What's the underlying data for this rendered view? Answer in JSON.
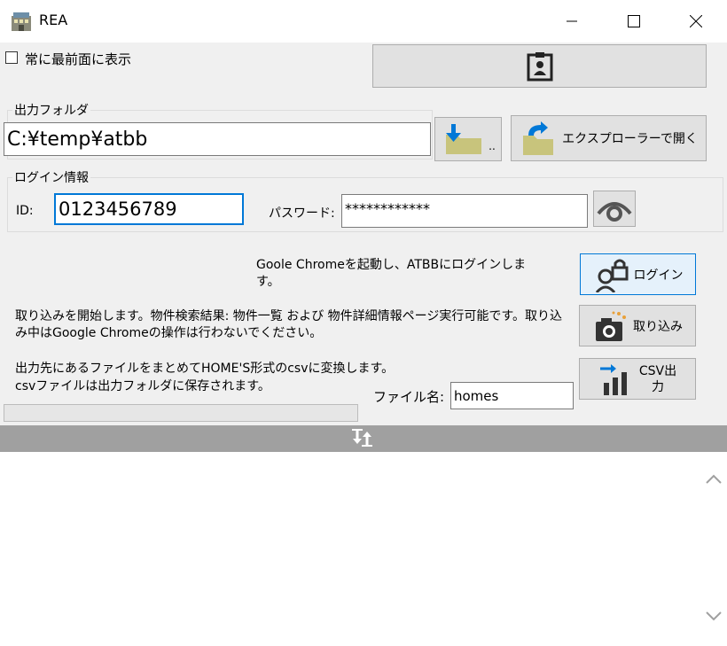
{
  "window": {
    "title": "REA"
  },
  "top": {
    "always_on_top_label": "常に最前面に表示"
  },
  "output_folder": {
    "legend": "出力フォルダ",
    "path_value": "C:¥temp¥atbb",
    "browse_suffix": "..",
    "open_explorer_label": "エクスプローラーで開く"
  },
  "login_info": {
    "legend": "ログイン情報",
    "id_label": "ID:",
    "id_value": "0123456789",
    "password_label": "パスワード:",
    "password_value": "************"
  },
  "actions": {
    "login_description": "Goole Chromeを起動し、ATBBにログインします。",
    "login_button": "ログイン",
    "import_description": "取り込みを開始します。物件検索結果: 物件一覧 および 物件詳細情報ページ実行可能です。取り込み中はGoogle Chromeの操作は行わないでください。",
    "import_button": "取り込み",
    "csv_description_1": "出力先にあるファイルをまとめてHOME'S形式のcsvに変換します。",
    "csv_description_2": "csvファイルは出力フォルダに保存されます。",
    "filename_label": "ファイル名:",
    "filename_value": "homes",
    "csv_button_line1": "CSV出",
    "csv_button_line2": "力"
  },
  "colors": {
    "accent": "#0078d7",
    "folder": "#c8c47c",
    "icon_dark": "#333333"
  },
  "icons": [
    "building-icon",
    "minimize-icon",
    "maximize-icon",
    "close-icon",
    "clipboard-person-icon",
    "download-folder-icon",
    "open-folder-icon",
    "eye-icon",
    "user-lock-icon",
    "camera-icon",
    "chart-icon",
    "swap-arrows-icon",
    "chevron-up-icon",
    "chevron-down-icon"
  ]
}
